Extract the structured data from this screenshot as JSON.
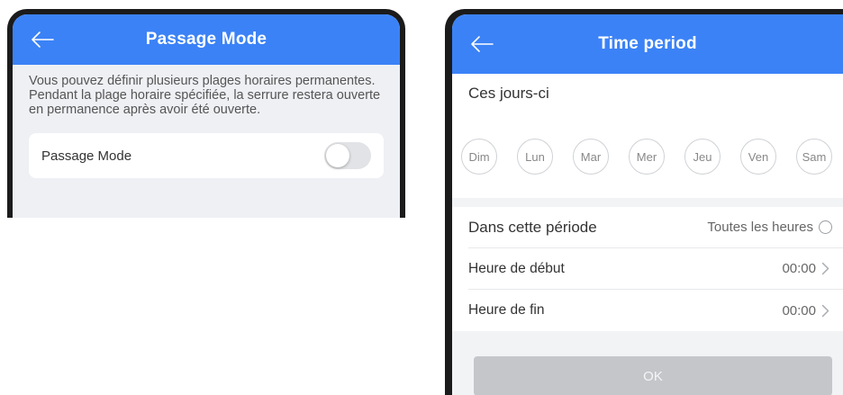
{
  "left": {
    "title": "Passage Mode",
    "description": "Vous pouvez définir plusieurs plages horaires permanentes. Pendant la plage horaire spécifiée, la serrure restera ouverte en permanence après avoir été ouverte.",
    "passage_mode_label": "Passage Mode",
    "passage_mode_enabled": false
  },
  "right": {
    "title": "Time period",
    "days_title": "Ces jours-ci",
    "days": [
      "Dim",
      "Lun",
      "Mar",
      "Mer",
      "Jeu",
      "Ven",
      "Sam"
    ],
    "period_label": "Dans cette période",
    "all_hours_label": "Toutes les heures",
    "start_label": "Heure de début",
    "start_value": "00:00",
    "end_label": "Heure de fin",
    "end_value": "00:00",
    "ok_label": "OK"
  },
  "colors": {
    "accent": "#3b82f6",
    "disabled_button": "#c4c6ca"
  },
  "icons": {
    "back": "arrow-left-icon",
    "chevron": "chevron-right-icon",
    "radio": "radio-empty-icon"
  }
}
